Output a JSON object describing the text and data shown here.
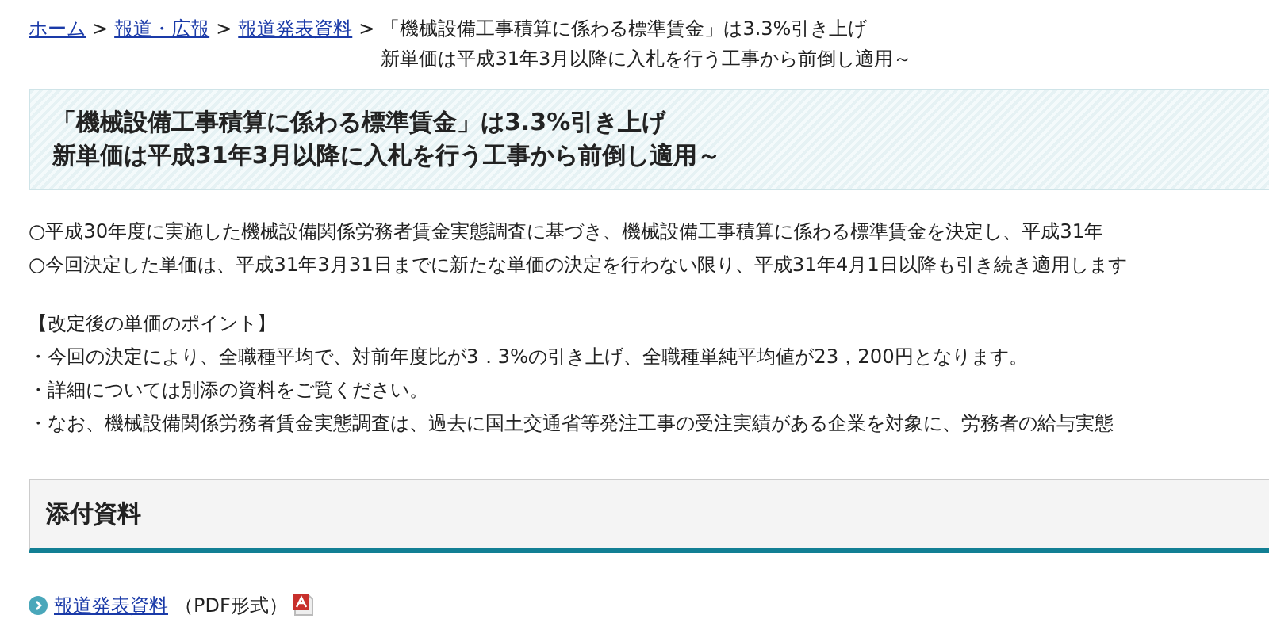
{
  "breadcrumb": [
    {
      "label": "ホーム",
      "link": true
    },
    {
      "label": "報道・広報",
      "link": true
    },
    {
      "label": "報道発表資料",
      "link": true
    },
    {
      "lines": [
        "「機械設備工事積算に係わる標準賃金」は3.3%引き上げ",
        "新単価は平成31年3月以降に入札を行う工事から前倒し適用～"
      ],
      "link": false
    }
  ],
  "breadcrumb_separator": ">",
  "title": {
    "lines": [
      "「機械設備工事積算に係わる標準賃金」は3.3%引き上げ",
      "新単価は平成31年3月以降に入札を行う工事から前倒し適用～"
    ]
  },
  "paragraphs": [
    [
      "○平成30年度に実施した機械設備関係労務者賃金実態調査に基づき、機械設備工事積算に係わる標準賃金を決定し、平成31年",
      "○今回決定した単価は、平成31年3月31日までに新たな単価の決定を行わない限り、平成31年4月1日以降も引き続き適用します"
    ],
    [
      "【改定後の単価のポイント】",
      "・今回の決定により、全職種平均で、対前年度比が3．3%の引き上げ、全職種単純平均値が23，200円となります。",
      "・詳細については別添の資料をご覧ください。",
      "・なお、機械設備関係労務者賃金実態調査は、過去に国土交通省等発注工事の受注実績がある企業を対象に、労務者の給与実態"
    ]
  ],
  "attachments": {
    "heading": "添付資料",
    "items": [
      {
        "link": "報道発表資料",
        "note": "（PDF形式）",
        "kind": "pdf"
      }
    ]
  }
}
